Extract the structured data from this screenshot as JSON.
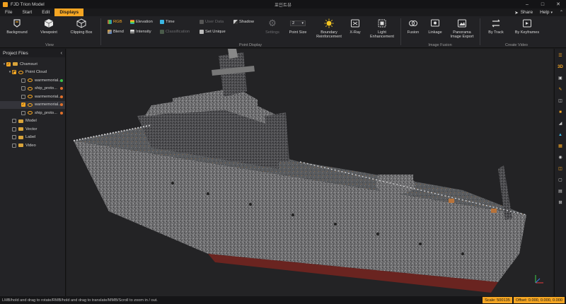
{
  "app": {
    "title": "FJD Trion Model",
    "document_title": "포인트뷰"
  },
  "menu": {
    "items": [
      "File",
      "Start",
      "Edit",
      "Displays"
    ],
    "active": "Displays",
    "share_label": "Share",
    "help_label": "Help"
  },
  "ribbon": {
    "view": {
      "label": "View",
      "background": "Background",
      "viewpoint": "Viewpoint",
      "clipping_box": "Clipping Box"
    },
    "point_display": {
      "label": "Point Display",
      "rgb": "RGB",
      "blend": "Blend",
      "elevation": "Elevation",
      "intensity": "Intensity",
      "time": "Time",
      "classification": "Classification",
      "user_data": "User Data",
      "set_unique": "Set Unique",
      "shadow": "Shadow",
      "settings": "Settings",
      "point_size": "Point Size",
      "point_size_value": "2",
      "boundary": "Boundary Reinforcement",
      "xray": "X-Ray",
      "light": "Light Enhancement"
    },
    "image_fusion": {
      "label": "Image Fusion",
      "fusion": "Fusion",
      "linkage": "Linkage",
      "panorama": "Panorama Image Export"
    },
    "create_video": {
      "label": "Create Video",
      "by_track": "By Track",
      "by_keyframes": "By Keyframes"
    }
  },
  "panel": {
    "title": "Project Files",
    "root": "Chamsuri",
    "point_cloud": "Point Cloud",
    "files": [
      {
        "name": "warmemorial...",
        "color": "#3cc44a",
        "checked": false
      },
      {
        "name": "ship_proto...",
        "color": "#e0702a",
        "checked": false
      },
      {
        "name": "warmemorial...",
        "color": "#e0702a",
        "checked": false
      },
      {
        "name": "warmemorial...",
        "color": "#e0702a",
        "checked": true
      },
      {
        "name": "ship_proto...",
        "color": "#e0702a",
        "checked": false
      }
    ],
    "others": [
      "Model",
      "Vector",
      "Label",
      "Video"
    ]
  },
  "righttool": [
    "layers-icon",
    "3D",
    "lock-icon",
    "measure-icon",
    "slice-icon",
    "color-icon",
    "filter-icon",
    "dataset-icon",
    "grid-icon",
    "camera-icon",
    "cube-icon",
    "box-icon",
    "image-icon",
    "crop-icon"
  ],
  "status": {
    "hint": "LMB/hold and drag to rotate/RMB/hold and drag to translate/MMB/Scroll to zoom in / out.",
    "scale": "Scale: 500135",
    "offset": "Offset: 0.000, 0.000, 0.000"
  },
  "colors": {
    "accent": "#f5a623",
    "background": "#1c1c1e"
  }
}
